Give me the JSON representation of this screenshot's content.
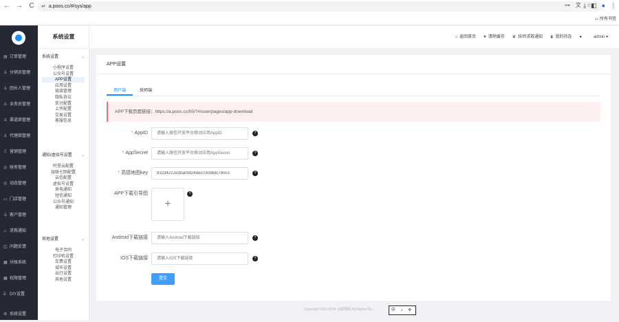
{
  "browser": {
    "url": "a.poos.cc/#/sys/app",
    "bookmarks_label": "所有书签",
    "nav": [
      "←",
      "→",
      "C"
    ],
    "url_icons": [
      "⊶",
      "文",
      "☆"
    ],
    "actions": [
      "⤓",
      "◧",
      "●",
      "⋮"
    ]
  },
  "sidebar": {
    "items": [
      {
        "icon": "▤",
        "label": "订单管理"
      },
      {
        "icon": "♙",
        "label": "分销员管理"
      },
      {
        "icon": "♙",
        "label": "团长人管理"
      },
      {
        "icon": "♙",
        "label": "业务员管理"
      },
      {
        "icon": "♙",
        "label": "渠道商管理"
      },
      {
        "icon": "♙",
        "label": "代理商管理"
      },
      {
        "icon": "♖",
        "label": "营销管理"
      },
      {
        "icon": "◎",
        "label": "财务管理"
      },
      {
        "icon": "◎",
        "label": "动态管理"
      },
      {
        "icon": "▭",
        "label": "门店管理"
      },
      {
        "icon": "♙",
        "label": "客户管理"
      },
      {
        "icon": "♫",
        "label": "求救通知"
      },
      {
        "icon": "◫",
        "label": "问题反馈"
      },
      {
        "icon": "▦",
        "label": "分账系统"
      },
      {
        "icon": "▦",
        "label": "权限管理"
      },
      {
        "icon": "⌸",
        "label": "DIY设置"
      },
      {
        "icon": "⚙",
        "label": "系统设置"
      }
    ]
  },
  "subnav": {
    "title": "系统设置",
    "groups": [
      {
        "title": "系统设置",
        "items": [
          "小程序设置",
          "公众号设置",
          "APP设置",
          "应用设置",
          "链接管理",
          "隐私协议",
          "支付配置",
          "上传配置",
          "交易设置",
          "客服信息"
        ]
      },
      {
        "title": "通知/虚拟号设置",
        "items": [
          "阿里云配置",
          "容联七陌配置",
          "云信配置",
          "虚拟号设置",
          "来电通知",
          "短信通知",
          "公众号通知",
          "通知管理"
        ]
      },
      {
        "title": "其他设置",
        "items": [
          "电子合同",
          "打印机设置",
          "车费设置",
          "城市设置",
          "出行设置",
          "其他设置"
        ]
      }
    ]
  },
  "topbar": {
    "links": [
      {
        "icon": "⌂",
        "label": "返回首页"
      },
      {
        "icon": "♥",
        "label": "清除缓存"
      },
      {
        "icon": "♛",
        "label": "技师求救通知"
      },
      {
        "icon": "⧗",
        "label": "我的待办"
      },
      {
        "icon": "●",
        "label": ""
      },
      {
        "icon": "",
        "label": "admin ▾"
      }
    ]
  },
  "main": {
    "title": "APP设置",
    "tabs": [
      "用户端",
      "技师端"
    ],
    "active_tab": 0,
    "alert": "APP下载页面链接：https://a.poos.cc/h5/?#/user/pages/app-download",
    "form": {
      "appid": {
        "label": "AppID",
        "required": true,
        "placeholder": "请输入微信开放平台移动应用AppID",
        "value": ""
      },
      "appsecret": {
        "label": "AppSecret",
        "required": true,
        "placeholder": "请输入微信开放平台移动应用AppSecret",
        "value": ""
      },
      "map_key": {
        "label": "高德地图key",
        "required": true,
        "placeholder": "",
        "value": "932d4222e3ba09d24dec0309bdc780c3"
      },
      "guide_image": {
        "label": "APP下载引导图",
        "required": false,
        "plus": "+"
      },
      "android_link": {
        "label": "Android下载链接",
        "required": false,
        "placeholder": "请输入Android下载链接",
        "value": ""
      },
      "ios_link": {
        "label": "IOS下载链接",
        "required": false,
        "placeholder": "请输入IOS下载链接",
        "value": ""
      },
      "help_glyph": "?",
      "required_mark": "*"
    },
    "submit_label": "提交"
  },
  "footer": {
    "copyright": "Copyright 2020-2024 云邮网网 All Rights Re...",
    "overlay": "中 ♪ ✣"
  }
}
